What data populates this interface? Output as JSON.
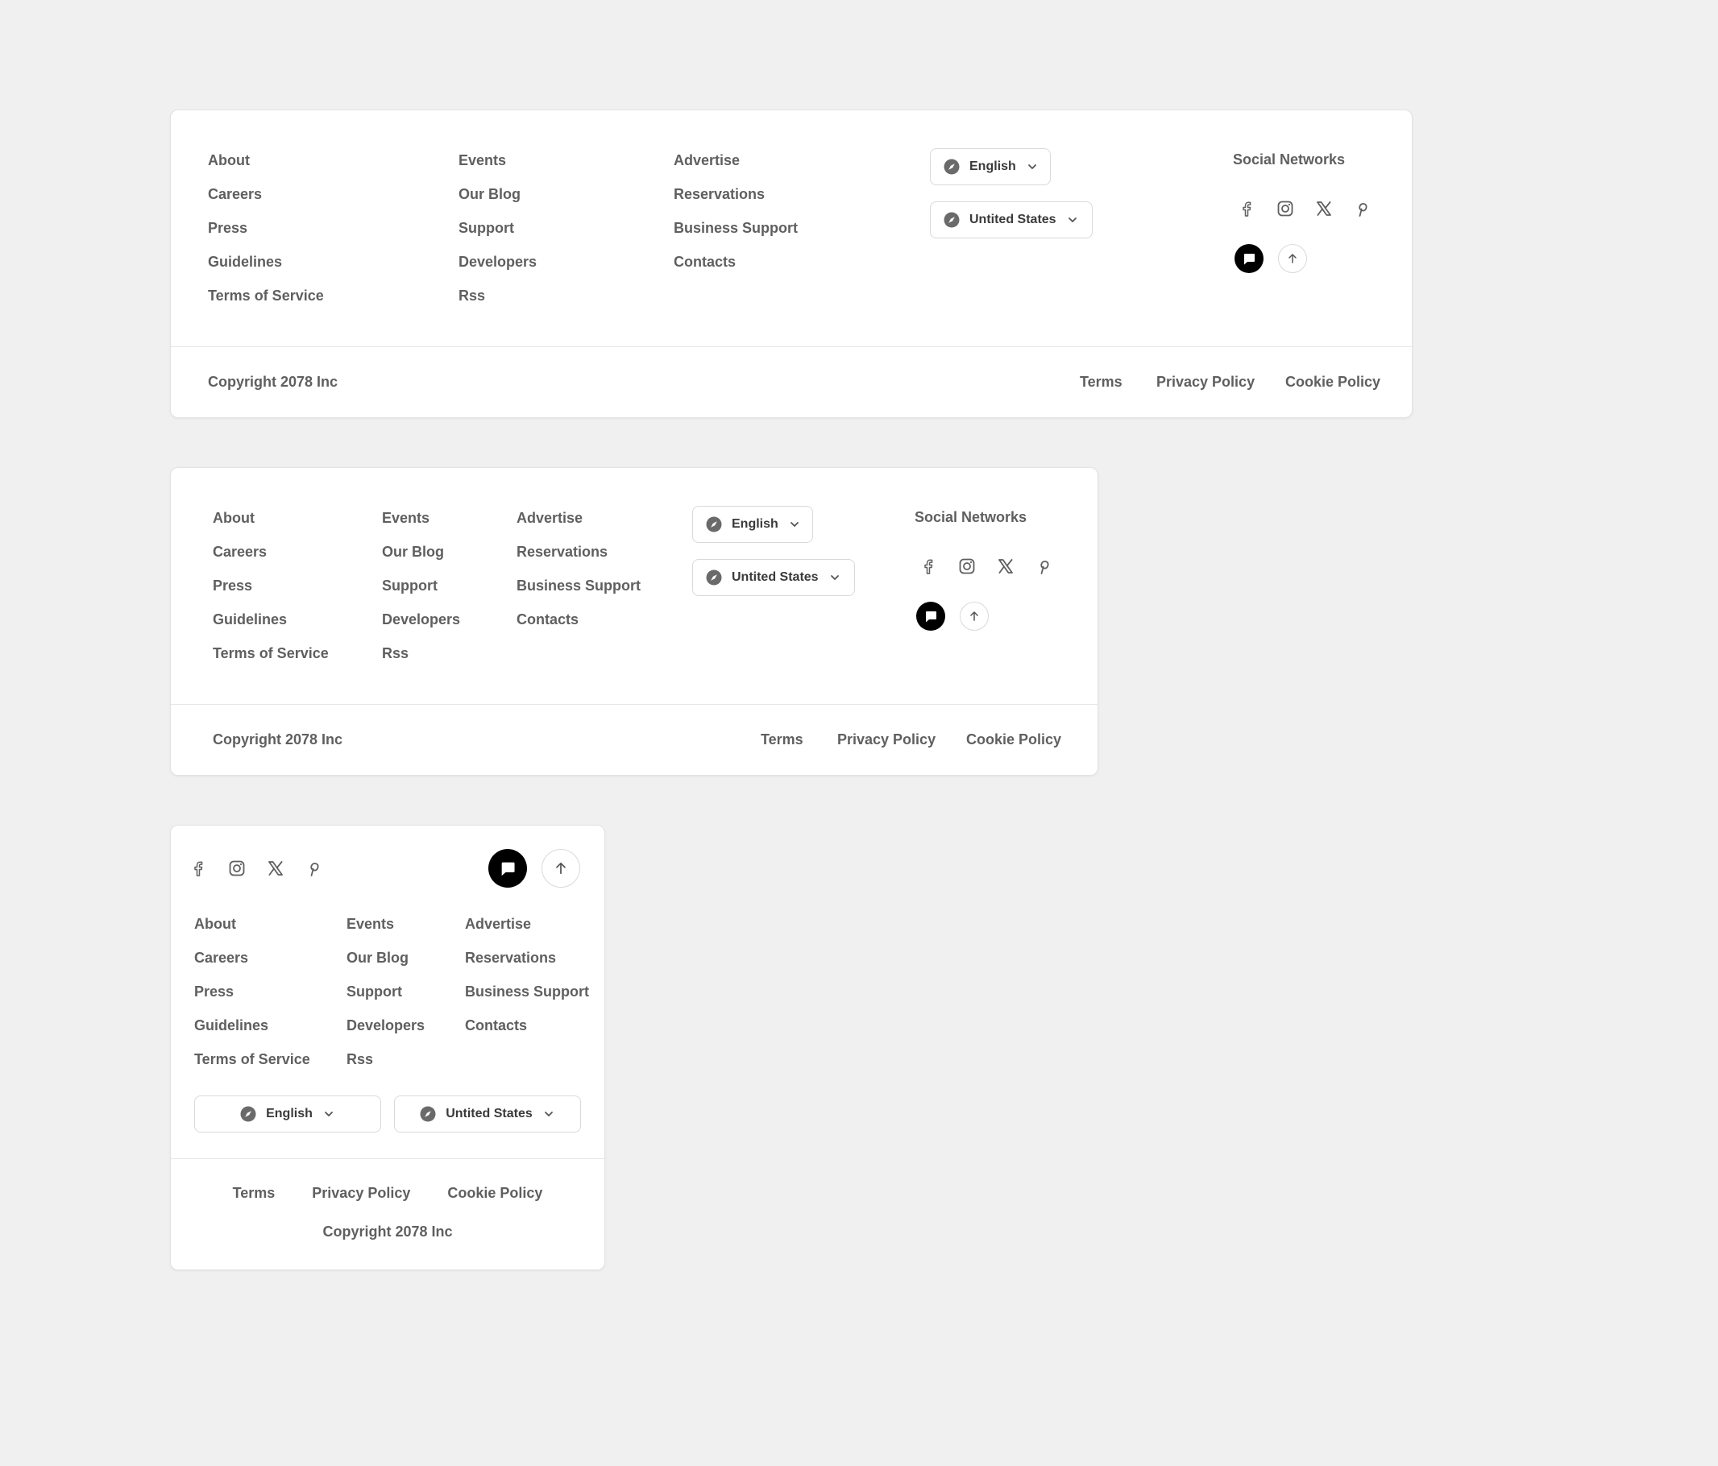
{
  "links": {
    "col1": [
      "About",
      "Careers",
      "Press",
      "Guidelines",
      "Terms of Service"
    ],
    "col2": [
      "Events",
      "Our Blog",
      "Support",
      "Developers",
      "Rss"
    ],
    "col3": [
      "Advertise",
      "Reservations",
      "Business Support",
      "Contacts"
    ]
  },
  "language": {
    "label": "English",
    "icon": "compass-icon"
  },
  "region": {
    "label": "Untited States",
    "icon": "compass-icon"
  },
  "social": {
    "heading": "Social Networks",
    "icons": [
      "facebook-icon",
      "instagram-icon",
      "x-icon",
      "pinterest-icon"
    ]
  },
  "actions": {
    "chat_icon": "chat-icon",
    "top_icon": "arrow-up-icon"
  },
  "bottom": {
    "copyright": "Copyright 2078 Inc",
    "terms": "Terms",
    "privacy": "Privacy Policy",
    "cookie": "Cookie Policy"
  },
  "colors": {
    "background": "#f0f0f0",
    "card": "#ffffff",
    "text": "#5f5f5f",
    "accent": "#000000"
  }
}
